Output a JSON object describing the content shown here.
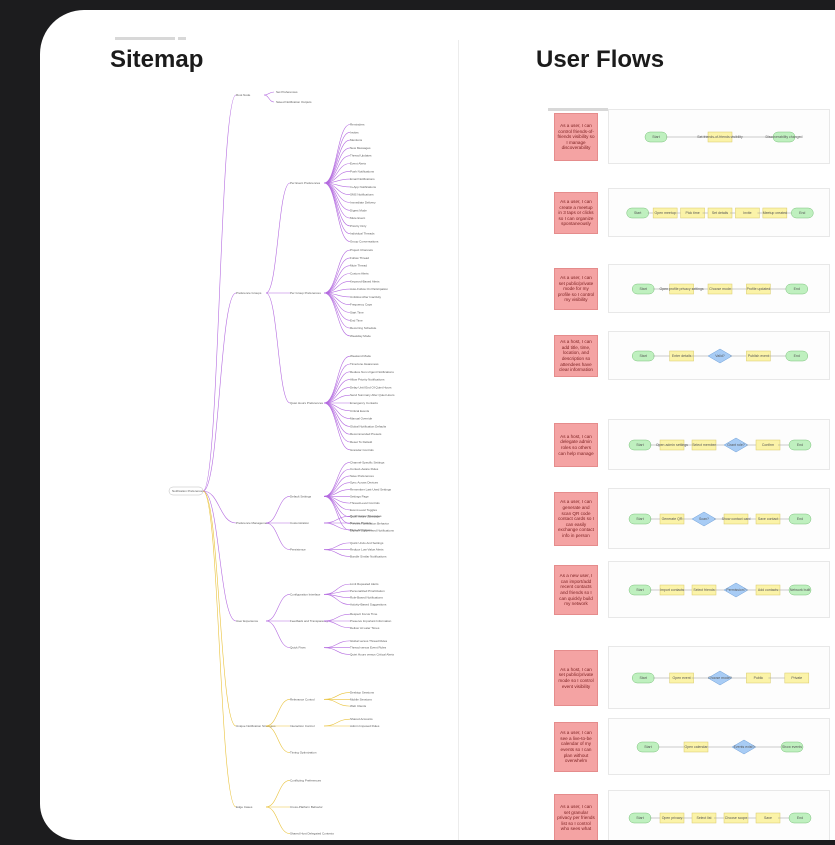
{
  "sitemap": {
    "title": "Sitemap",
    "root": "Notification Preferences",
    "branches": [
      {
        "label": "Root Node",
        "children": [
          "Set Preferences",
          "Saved Notification Outputs"
        ]
      },
      {
        "label": "Preference Groups",
        "children": [
          "Per Event Preferences",
          "Per Group Preferences",
          "Quiet Hours Preferences"
        ]
      },
      {
        "label": "Preference Management",
        "children": [
          "Default Settings",
          "Customization",
          "Persistence"
        ]
      },
      {
        "label": "User Experience",
        "children": [
          "Configuration Interface",
          "Feedback and Transparency",
          "Quick Fixes"
        ]
      },
      {
        "label": "Unique Notification Strategies",
        "children": [
          "Relevance Control",
          "Interaction Control",
          "Timing Optimization"
        ]
      },
      {
        "label": "Edge Cases",
        "children": [
          "Conflicting Preferences",
          "Cross-Platform Behavior",
          "Shared Host Delegated Contexts"
        ]
      }
    ],
    "leaves": [
      "Set Preferences",
      "Saved Notification Outputs",
      "Reminders",
      "Invites",
      "Mentions",
      "New Messages",
      "Thread Updates",
      "Event Alerts",
      "Push Notifications",
      "Email Notifications",
      "In-App Notifications",
      "SMS Notifications",
      "Immediate Delivery",
      "Digest Mode",
      "Mute Event",
      "Priority Only",
      "Individual Threads",
      "Group Conversations",
      "Project Channels",
      "Follow Thread",
      "Mute Thread",
      "Custom Alerts",
      "Keyword-Based Alerts",
      "Auto-Follow On Participation",
      "Unfollow After Inactivity",
      "Frequency Caps",
      "Start Time",
      "End Time",
      "Recurring Schedule",
      "Weekday Mode",
      "Weekend Mode",
      "Timezone Awareness",
      "Reduce Non-Urgent Notifications",
      "Allow Priority Notifications",
      "Delay Until End Of Quiet Hours",
      "Send Summary After Quiet Hours",
      "Emergency Contacts",
      "Critical Events",
      "Manual Override",
      "Global Notification Defaults",
      "Recommended Presets",
      "Reset To Default",
      "Granular Controls",
      "Channel-Specific Settings",
      "Context-Aware Rules",
      "Save Preferences",
      "Sync Across Devices",
      "Remember Last-Used Settings",
      "Settings Page",
      "Thread-Level Controls",
      "Event-Level Toggles",
      "Quiet Hours Scheduler",
      "Preview Notification Behavior",
      "Explain Suppressed Notifications",
      "Confirmation Messages",
      "Snooze Presets",
      "Mute All Options",
      "Quick Undo And Settings",
      "Reduce Low-Value Alerts",
      "Bundle Similar Notifications",
      "Limit Repeated Alerts",
      "Personalized Prioritization",
      "Role-Based Notifications",
      "Activity-Based Suggestions",
      "Respect Focus Time",
      "Preserve Important Information",
      "Deliver At Later Times",
      "Global versus Thread Rules",
      "Thread versus Event Rules",
      "Quiet Hours versus Critical Alerts",
      "Desktop Sessions",
      "Mobile Sessions",
      "Web Clients",
      "Shared Accounts",
      "Admin Imposed Rules"
    ]
  },
  "user_flows": {
    "title": "User Flows",
    "flows": [
      {
        "story": "As a user, I can control friends-of-friends visibility so I manage discoverability",
        "steps": [
          "Start",
          "Set friends-of-friends visibility",
          "Discoverability changed"
        ]
      },
      {
        "story": "As a user, I can create a meetup in 3 taps or clicks so I can organize spontaneously",
        "steps": [
          "Start",
          "Open meetup",
          "Pick time",
          "Set details",
          "Invite",
          "Meetup created",
          "End"
        ]
      },
      {
        "story": "As a user, I can set public/private mode for my profile so I control my visibility",
        "steps": [
          "Start",
          "Open profile privacy settings",
          "Choose mode",
          "Profile updated",
          "End"
        ]
      },
      {
        "story": "As a host, I can add title, time, location, and description so attendees have clear information",
        "steps": [
          "Start",
          "Enter details",
          "Valid?",
          "Publish event",
          "End"
        ]
      },
      {
        "story": "As a host, I can delegate admin roles so others can help manage",
        "steps": [
          "Start",
          "Open admin settings",
          "Select member",
          "Grant role?",
          "Confirm",
          "End"
        ]
      },
      {
        "story": "As a user, I can generate and scan QR code contact cards so I can easily exchange contact info in person",
        "steps": [
          "Start",
          "Generate QR",
          "Scan?",
          "Show contact card",
          "Save contact",
          "End"
        ]
      },
      {
        "story": "As a new user, I can import/add recent contacts and friends so I can quickly build my network",
        "steps": [
          "Start",
          "Import contacts",
          "Select friends",
          "Permission?",
          "Add contacts",
          "Network built"
        ]
      },
      {
        "story": "As a host, I can set public/private mode so I control event visibility",
        "steps": [
          "Start",
          "Open event",
          "Choose mode?",
          "Public",
          "Private"
        ]
      },
      {
        "story": "As a user, I can see a live-to-be calendar of my events so I can plan without overwhelm",
        "steps": [
          "Start",
          "Open calendar",
          "Events exist?",
          "Show events"
        ]
      },
      {
        "story": "As a user, I can set granular privacy per friends list so I control who sees what",
        "steps": [
          "Start",
          "Open privacy",
          "Select list",
          "Choose scope",
          "Save",
          "End"
        ]
      }
    ]
  },
  "colors": {
    "background": "#1c1c1e",
    "board": "#ffffff",
    "story": "#f4a3a3",
    "terminal": "#bff0bf",
    "process": "#fbf3a8",
    "decision": "#a8ccf5",
    "branch_purple": "#b46be0",
    "branch_yellow": "#e9c23a"
  }
}
